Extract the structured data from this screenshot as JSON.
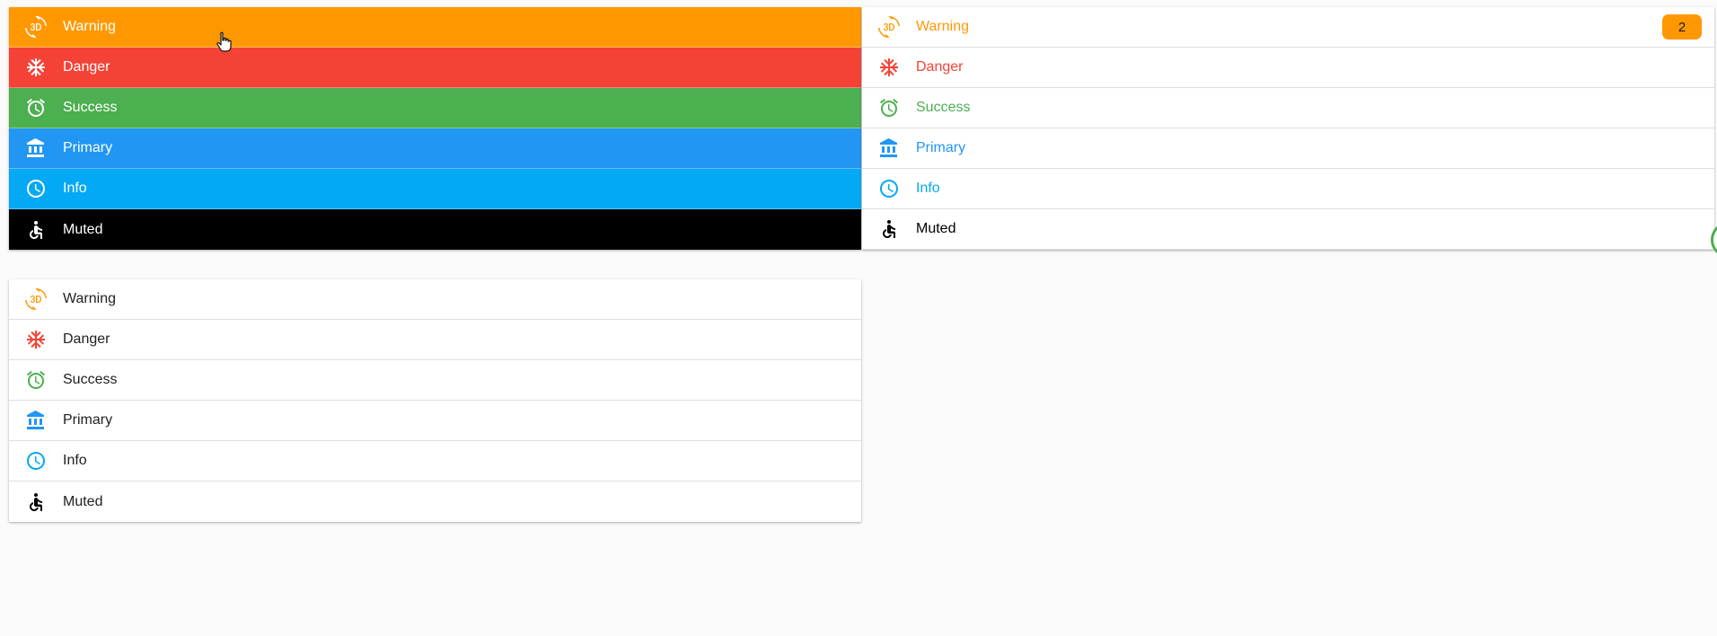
{
  "colors": {
    "warning": "#ff9800",
    "danger": "#f44336",
    "success": "#4caf50",
    "primary": "#2196f3",
    "info": "#03a9f4",
    "muted": "#000000",
    "plain_text": "#212121"
  },
  "items": [
    {
      "key": "warning",
      "label": "Warning",
      "icon": "3d-rotation-icon"
    },
    {
      "key": "danger",
      "label": "Danger",
      "icon": "snowflake-icon"
    },
    {
      "key": "success",
      "label": "Success",
      "icon": "alarm-clock-icon"
    },
    {
      "key": "primary",
      "label": "Primary",
      "icon": "bank-icon"
    },
    {
      "key": "info",
      "label": "Info",
      "icon": "clock-icon"
    },
    {
      "key": "muted",
      "label": "Muted",
      "icon": "accessible-icon"
    }
  ],
  "lists": {
    "colored": {
      "items": [
        "Warning",
        "Danger",
        "Success",
        "Primary",
        "Info",
        "Muted"
      ]
    },
    "text": {
      "items": [
        "Warning",
        "Danger",
        "Success",
        "Primary",
        "Info",
        "Muted"
      ],
      "badge": "2"
    },
    "plain": {
      "items": [
        "Warning",
        "Danger",
        "Success",
        "Primary",
        "Info",
        "Muted"
      ]
    }
  }
}
